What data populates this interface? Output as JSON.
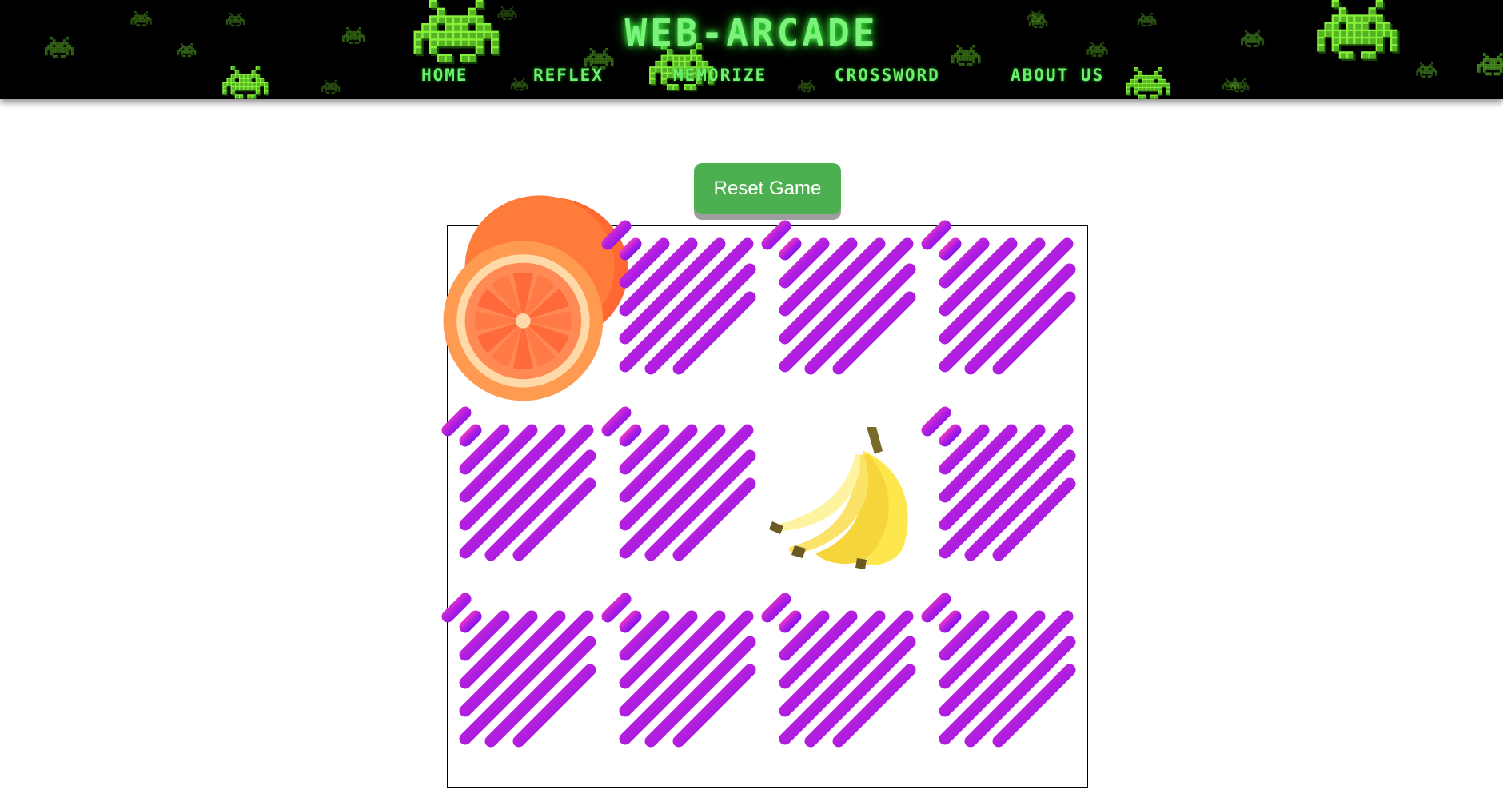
{
  "header": {
    "brand": "WEB-ARCADE",
    "nav": [
      {
        "label": "HOME",
        "active": false
      },
      {
        "label": "REFLEX",
        "active": false
      },
      {
        "label": "MEMORIZE",
        "active": true
      },
      {
        "label": "CROSSWORD",
        "active": false
      },
      {
        "label": "ABOUT US",
        "active": false
      }
    ],
    "invader_icon": "space-invader-icon",
    "colors": {
      "background": "#000000",
      "text": "#6cf06c",
      "invader": "#86f23a"
    }
  },
  "controls": {
    "reset_label": "Reset Game",
    "reset_color": "#4caf50"
  },
  "board": {
    "rows": 3,
    "columns": 4,
    "card_back_icon": "diagonal-stripes-pattern",
    "card_back_colors": [
      "#ff3fbf",
      "#b01ee0",
      "#7a10f0"
    ],
    "cards": [
      {
        "state": "face-up",
        "icon": "orange-icon"
      },
      {
        "state": "face-down"
      },
      {
        "state": "face-down"
      },
      {
        "state": "face-down"
      },
      {
        "state": "face-down"
      },
      {
        "state": "face-down"
      },
      {
        "state": "face-up",
        "icon": "banana-icon"
      },
      {
        "state": "face-down"
      },
      {
        "state": "face-down"
      },
      {
        "state": "face-down"
      },
      {
        "state": "face-down"
      },
      {
        "state": "face-down"
      }
    ]
  }
}
